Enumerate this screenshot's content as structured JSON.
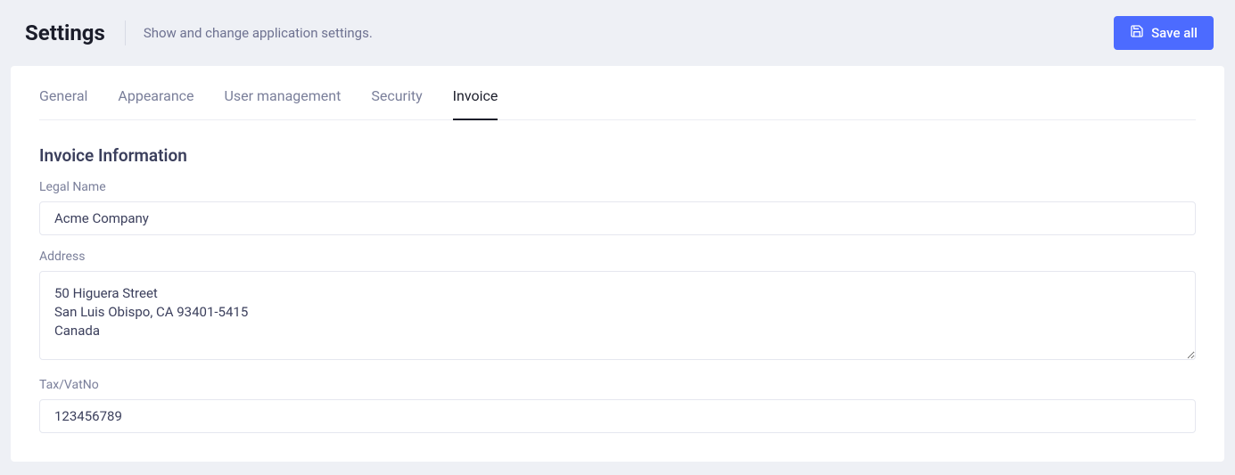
{
  "header": {
    "title": "Settings",
    "subtitle": "Show and change application settings.",
    "save_label": "Save all"
  },
  "tabs": [
    {
      "label": "General",
      "active": false
    },
    {
      "label": "Appearance",
      "active": false
    },
    {
      "label": "User management",
      "active": false
    },
    {
      "label": "Security",
      "active": false
    },
    {
      "label": "Invoice",
      "active": true
    }
  ],
  "section": {
    "title": "Invoice Information"
  },
  "form": {
    "legal_name": {
      "label": "Legal Name",
      "value": "Acme Company"
    },
    "address": {
      "label": "Address",
      "value": "50 Higuera Street\nSan Luis Obispo, CA 93401-5415\nCanada"
    },
    "tax_vat": {
      "label": "Tax/VatNo",
      "value": "123456789"
    }
  }
}
